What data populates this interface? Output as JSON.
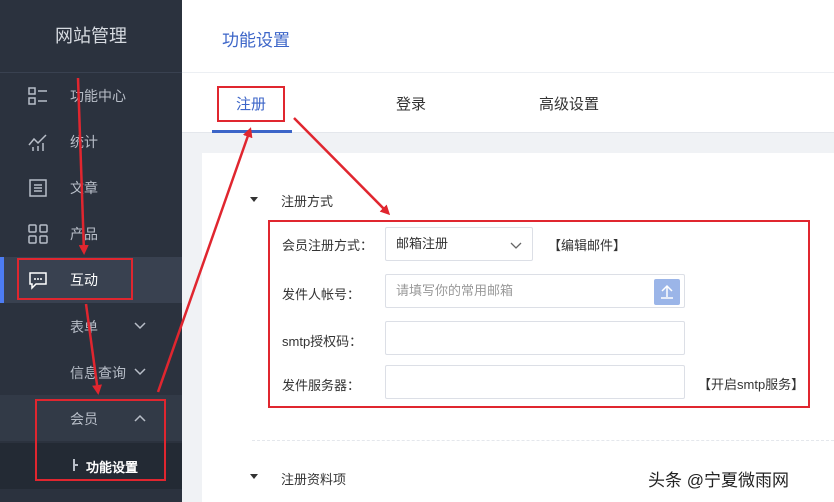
{
  "sidebar": {
    "title": "网站管理",
    "items": [
      {
        "label": "功能中心",
        "icon": "grid-list-icon"
      },
      {
        "label": "统计",
        "icon": "chart-icon"
      },
      {
        "label": "文章",
        "icon": "document-icon"
      },
      {
        "label": "产品",
        "icon": "apps-icon"
      },
      {
        "label": "互动",
        "icon": "message-icon"
      }
    ],
    "subitems": [
      {
        "label": "表单"
      },
      {
        "label": "信息查询"
      },
      {
        "label": "会员"
      }
    ],
    "leaf": {
      "label": "功能设置"
    }
  },
  "header": {
    "title": "功能设置"
  },
  "tabs": [
    {
      "label": "注册"
    },
    {
      "label": "登录"
    },
    {
      "label": "高级设置"
    }
  ],
  "form": {
    "section1": "注册方式",
    "section2": "注册资料项",
    "method_label": "会员注册方式：",
    "method_value": "邮箱注册",
    "edit_mail": "【编辑邮件】",
    "sender_label": "发件人帐号：",
    "sender_placeholder": "请填写你的常用邮箱",
    "smtp_label": "smtp授权码：",
    "server_label": "发件服务器：",
    "open_smtp": "【开启smtp服务】"
  },
  "watermark": "头条 @宁夏微雨网",
  "colors": {
    "accent": "#3c65c8",
    "annotation": "#e0262f",
    "sidebar": "#2b323e"
  }
}
